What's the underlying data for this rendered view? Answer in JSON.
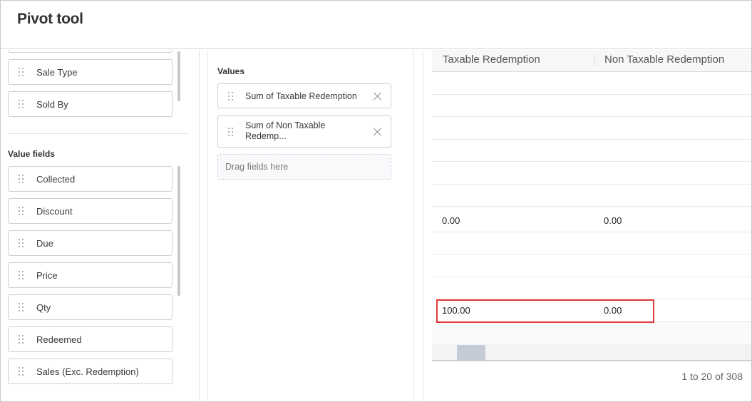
{
  "header": {
    "title": "Pivot tool"
  },
  "left_panel": {
    "row_fields": [
      "Sale Type",
      "Sold By"
    ],
    "value_fields_title": "Value fields",
    "value_fields": [
      "Collected",
      "Discount",
      "Due",
      "Price",
      "Qty",
      "Redeemed",
      "Sales (Exc. Redemption)"
    ]
  },
  "values_panel": {
    "title": "Values",
    "items": [
      "Sum of Taxable Redemption",
      "Sum of Non Taxable Redemp..."
    ],
    "drop_placeholder": "Drag fields here"
  },
  "grid": {
    "columns": [
      "Taxable Redemption",
      "Non Taxable Redemption"
    ],
    "rows": [
      [
        "",
        ""
      ],
      [
        "",
        ""
      ],
      [
        "",
        ""
      ],
      [
        "",
        ""
      ],
      [
        "",
        ""
      ],
      [
        "",
        ""
      ],
      [
        "0.00",
        "0.00"
      ],
      [
        "",
        ""
      ],
      [
        "",
        ""
      ],
      [
        "",
        ""
      ],
      [
        "100.00",
        "0.00"
      ],
      [
        "",
        ""
      ]
    ]
  },
  "pager": {
    "text": "1 to 20 of 308"
  },
  "icons": {
    "grip": "drag-handle-icon",
    "close": "close-icon"
  },
  "colors": {
    "highlight": "#e03b3b",
    "scroll_thumb": "#c5cbd6"
  }
}
